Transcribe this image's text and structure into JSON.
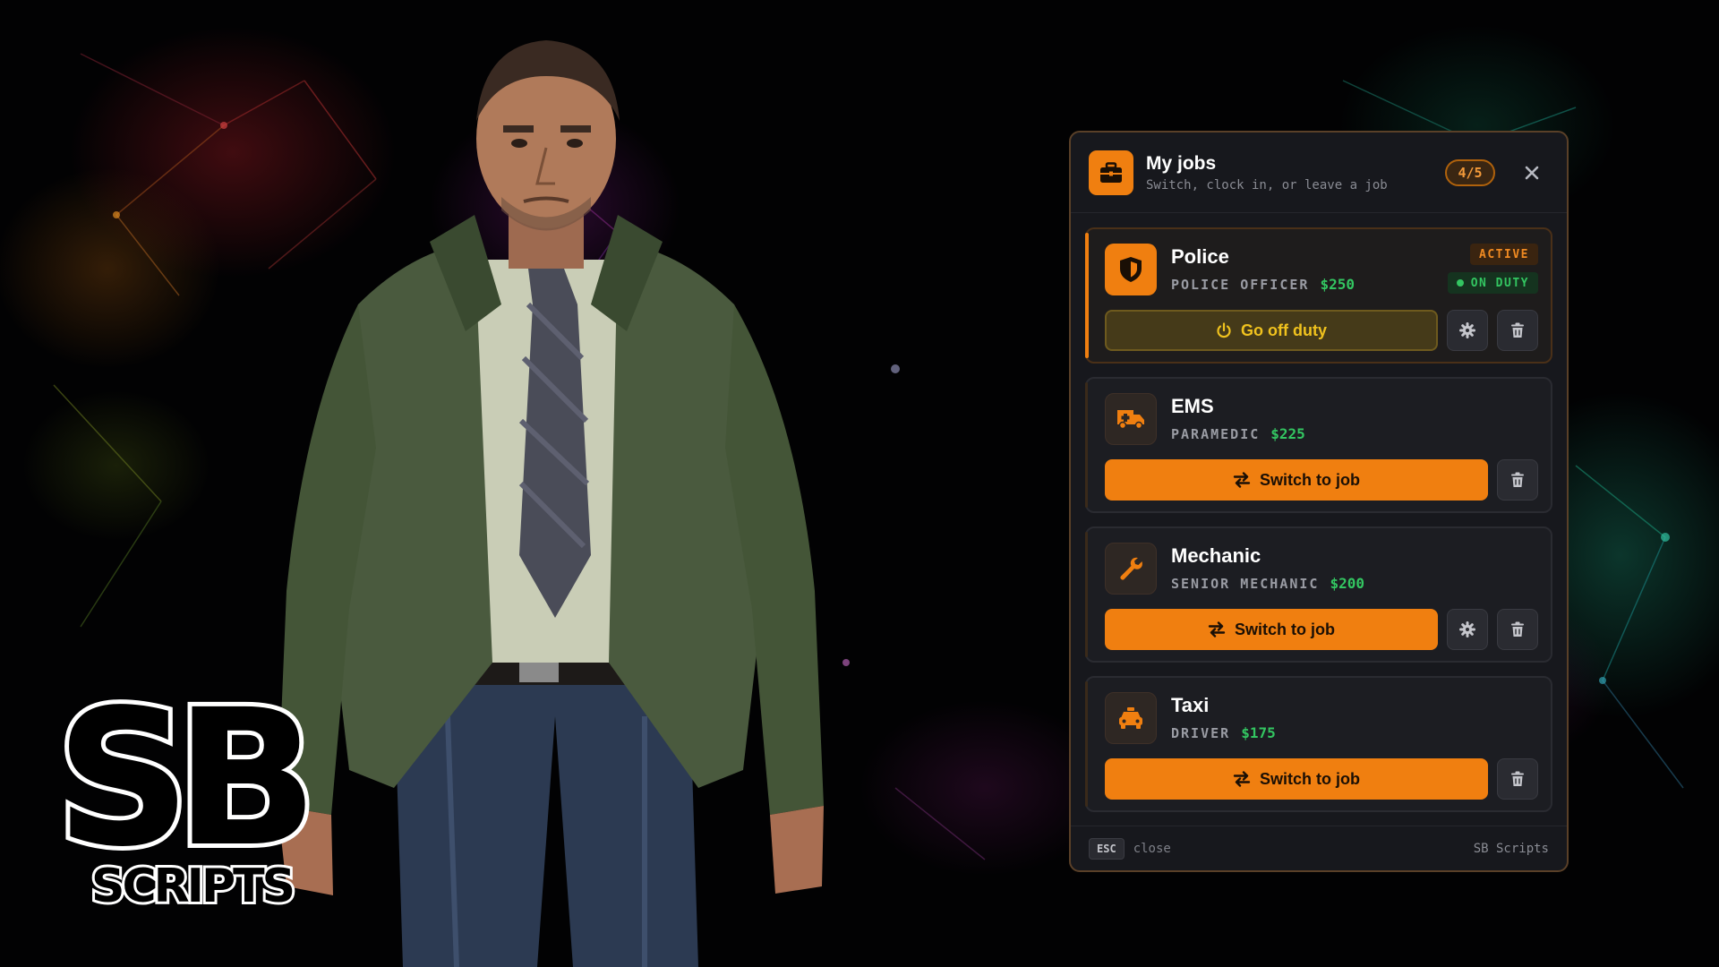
{
  "logo": {
    "main": "SB",
    "sub": "SCRIPTS"
  },
  "panel": {
    "title": "My jobs",
    "subtitle": "Switch, clock in, or leave a job",
    "count": "4/5",
    "close_icon": "close-icon"
  },
  "jobs": [
    {
      "name": "Police",
      "rank": "POLICE OFFICER",
      "pay": "$250",
      "icon": "shield-icon",
      "active_badge": "ACTIVE",
      "duty_badge": "ON DUTY",
      "action": "Go off duty",
      "action_icon": "power-icon"
    },
    {
      "name": "EMS",
      "rank": "PARAMEDIC",
      "pay": "$225",
      "icon": "ambulance-icon",
      "action": "Switch to job",
      "action_icon": "swap-icon"
    },
    {
      "name": "Mechanic",
      "rank": "SENIOR MECHANIC",
      "pay": "$200",
      "icon": "wrench-icon",
      "action": "Switch to job",
      "action_icon": "swap-icon"
    },
    {
      "name": "Taxi",
      "rank": "DRIVER",
      "pay": "$175",
      "icon": "taxi-icon",
      "action": "Switch to job",
      "action_icon": "swap-icon"
    }
  ],
  "footer": {
    "key": "ESC",
    "key_label": "close",
    "brand": "SB Scripts"
  },
  "colors": {
    "accent": "#f07f10",
    "pay_green": "#33c561",
    "panel_bg": "#17181d",
    "offduty_yellow": "#f0c21e"
  }
}
